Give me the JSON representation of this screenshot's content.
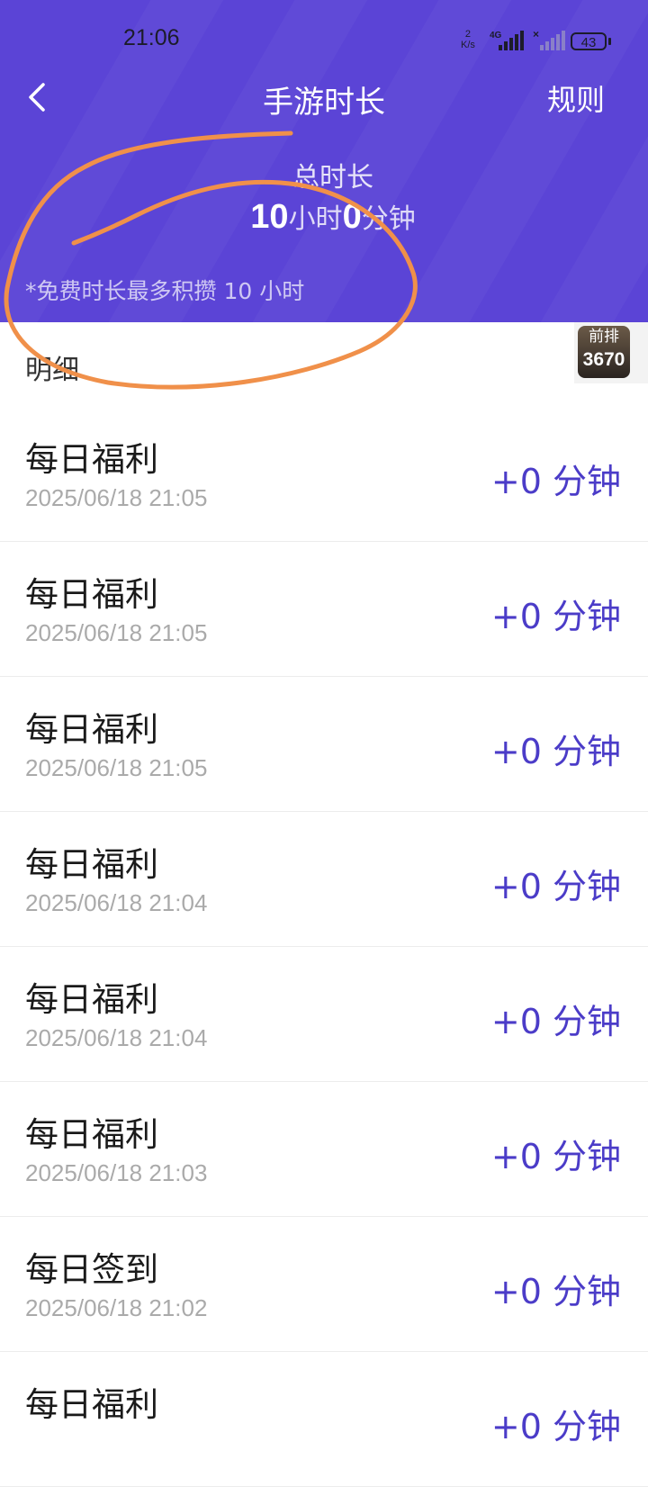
{
  "status_bar": {
    "time": "21:06",
    "net_speed_value": "2",
    "net_speed_unit": "K/s",
    "network_type": "4G",
    "battery": "43"
  },
  "header": {
    "title": "手游时长",
    "rules_label": "规则",
    "total_label": "总时长",
    "hours": "10",
    "hours_unit": "小时",
    "minutes": "0",
    "minutes_unit": "分钟",
    "note": "*免费时长最多积攒 10 小时"
  },
  "colors": {
    "header_bg": "#5b44d6",
    "accent": "#4b3cc8",
    "annotation": "#f0904a"
  },
  "details": {
    "title": "明细",
    "badge_label": "前排",
    "badge_count": "3670",
    "items": [
      {
        "title": "每日福利",
        "time": "2025/06/18 21:05",
        "amount": "+0 分钟"
      },
      {
        "title": "每日福利",
        "time": "2025/06/18 21:05",
        "amount": "+0 分钟"
      },
      {
        "title": "每日福利",
        "time": "2025/06/18 21:05",
        "amount": "+0 分钟"
      },
      {
        "title": "每日福利",
        "time": "2025/06/18 21:04",
        "amount": "+0 分钟"
      },
      {
        "title": "每日福利",
        "time": "2025/06/18 21:04",
        "amount": "+0 分钟"
      },
      {
        "title": "每日福利",
        "time": "2025/06/18 21:03",
        "amount": "+0 分钟"
      },
      {
        "title": "每日签到",
        "time": "2025/06/18 21:02",
        "amount": "+0 分钟"
      },
      {
        "title": "每日福利",
        "time": "",
        "amount": "+0 分钟"
      }
    ]
  }
}
